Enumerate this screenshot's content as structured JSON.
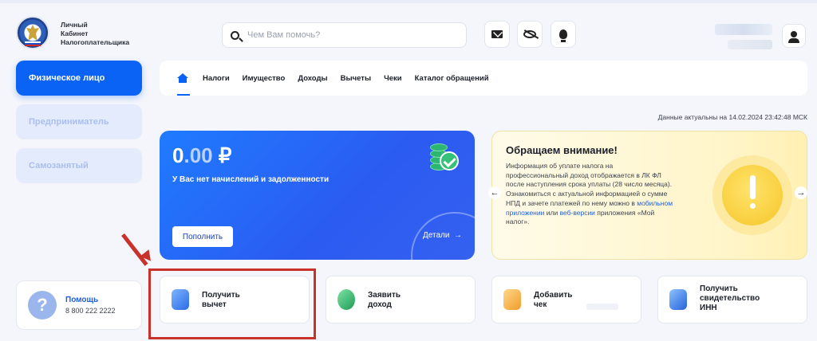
{
  "header": {
    "brand_lines": [
      "Личный",
      "Кабинет",
      "Налогоплательщика"
    ],
    "search_placeholder": "Чем Вам помочь?"
  },
  "sidebar": {
    "items": [
      {
        "label": "Физическое лицо",
        "active": true
      },
      {
        "label": "Предприниматель",
        "active": false
      },
      {
        "label": "Самозанятый",
        "active": false
      }
    ],
    "help": {
      "title": "Помощь",
      "phone": "8 800 222 2222"
    }
  },
  "nav": {
    "items": [
      "Налоги",
      "Имущество",
      "Доходы",
      "Вычеты",
      "Чеки",
      "Каталог обращений"
    ]
  },
  "status": {
    "actual_text": "Данные актуальны на 14.02.2024 23:42:48 МСК"
  },
  "balance": {
    "amount_int": "0",
    "amount_dec": ".00",
    "currency": "₽",
    "message": "У Вас нет начислений и задолженности",
    "topup_label": "Пополнить",
    "details_label": "Детали"
  },
  "notice": {
    "title": "Обращаем внимание!",
    "text1": "Информация об уплате налога на профессиональный доход отображается в ЛК ФЛ после наступления срока уплаты (28 число месяца).",
    "text2": "Ознакомиться с актуальной информацией о сумме НПД и зачете платежей по нему можно в ",
    "link1": "мобильном приложении",
    "text_or": " или ",
    "link2": "веб-версии",
    "text3": " приложения «Мой налог»."
  },
  "tiles": [
    {
      "label": "Получить\nвычет"
    },
    {
      "label": "Заявить\nдоход"
    },
    {
      "label": "Добавить\nчек"
    },
    {
      "label": "Получить\nсвидетельство\nИНН"
    }
  ],
  "colors": {
    "accent": "#0b63f6",
    "highlight": "#c8322b"
  }
}
